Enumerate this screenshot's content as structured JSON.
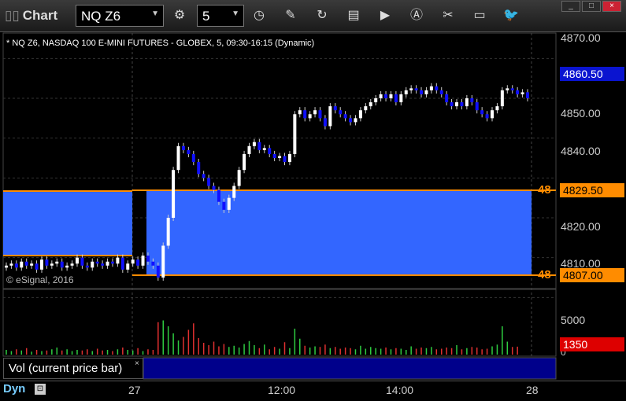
{
  "window": {
    "title": "Chart",
    "minimize": "_",
    "maximize": "□",
    "close": "×"
  },
  "toolbar": {
    "symbol": "NQ Z6",
    "interval": "5",
    "icons": [
      "draw-icon",
      "refresh-icon",
      "chart-type-icon",
      "play-icon",
      "alert-icon",
      "tools-icon",
      "comment-icon",
      "twitter-icon"
    ]
  },
  "chart": {
    "description": "* NQ Z6, NASDAQ 100 E-MINI FUTURES - GLOBEX, 5, 09:30-16:15 (Dynamic)",
    "copyright": "© eSignal, 2016",
    "price_axis": [
      "4870.00",
      "4850.00",
      "4840.00",
      "4820.00",
      "4810.00"
    ],
    "current_price": "4860.50",
    "levels": [
      {
        "label": "48",
        "price": "4829.50"
      },
      {
        "label": "48",
        "price": "4807.00"
      }
    ],
    "time_axis": [
      "27",
      "12:00",
      "14:00",
      "28"
    ],
    "colors": {
      "up": "#ffffff",
      "down": "#1010ff",
      "zone": "#3366ff",
      "level": "#ff8c00",
      "vol_up": "#2ecc40",
      "vol_down": "#e03030"
    }
  },
  "volume": {
    "label": "Vol (current price bar)",
    "close": "×",
    "axis": [
      "5000",
      "0"
    ],
    "current": "1350"
  },
  "footer": {
    "mode": "Dyn",
    "lock": "🔒"
  },
  "chart_data": {
    "type": "candlestick",
    "ylim": [
      4800,
      4875
    ],
    "series": [
      {
        "name": "price",
        "values": [
          4818,
          4818.5,
          4817.5,
          4819,
          4818,
          4818.5,
          4817,
          4819.5,
          4818,
          4818.5,
          4819,
          4817.5,
          4818,
          4818.5,
          4820,
          4818,
          4817.5,
          4819,
          4818.5,
          4818,
          4819,
          4818.5,
          4820,
          4817,
          4818.5,
          4819.5,
          4818,
          4820.5,
          4819,
          4818,
          4815,
          4823,
          4830,
          4842,
          4848,
          4847,
          4846,
          4844,
          4841,
          4840,
          4838,
          4837,
          4834,
          4832,
          4835,
          4838,
          4842,
          4846,
          4848,
          4849,
          4847,
          4847.5,
          4846,
          4845,
          4845.5,
          4844,
          4846,
          4856,
          4857,
          4855,
          4856,
          4857,
          4855,
          4853,
          4858,
          4857,
          4856,
          4855,
          4854,
          4855,
          4857,
          4858,
          4859,
          4860,
          4861,
          4860,
          4861,
          4859,
          4861,
          4862,
          4862.5,
          4862,
          4861,
          4862,
          4863,
          4862,
          4861,
          4859,
          4858,
          4859,
          4858,
          4860,
          4859,
          4857,
          4856,
          4855,
          4857,
          4858,
          4862,
          4862.5,
          4862,
          4861,
          4861.5,
          4860
        ]
      }
    ],
    "volume": [
      800,
      600,
      900,
      700,
      1100,
      500,
      800,
      600,
      700,
      900,
      1200,
      700,
      900,
      600,
      800,
      700,
      900,
      600,
      1000,
      700,
      800,
      600,
      900,
      1200,
      800,
      700,
      1100,
      600,
      900,
      800,
      5500,
      5800,
      4800,
      3600,
      2400,
      3000,
      4200,
      5300,
      2800,
      2000,
      1600,
      2200,
      1400,
      1800,
      1300,
      1500,
      1200,
      1800,
      2300,
      1600,
      1100,
      1700,
      900,
      1300,
      1000,
      2100,
      1100,
      4400,
      2700,
      1500,
      1200,
      1400,
      1300,
      1700,
      1100,
      1300,
      1000,
      1200,
      1100,
      900,
      1500,
      1000,
      1300,
      1100,
      1000,
      1200,
      900,
      1100,
      1000,
      800,
      1400,
      1000,
      1200,
      1100,
      1300,
      900,
      1000,
      1200,
      1100,
      1600,
      900,
      1100,
      1300,
      1200,
      900,
      1000,
      1400,
      1700,
      4800,
      2200,
      1300,
      1350
    ]
  }
}
